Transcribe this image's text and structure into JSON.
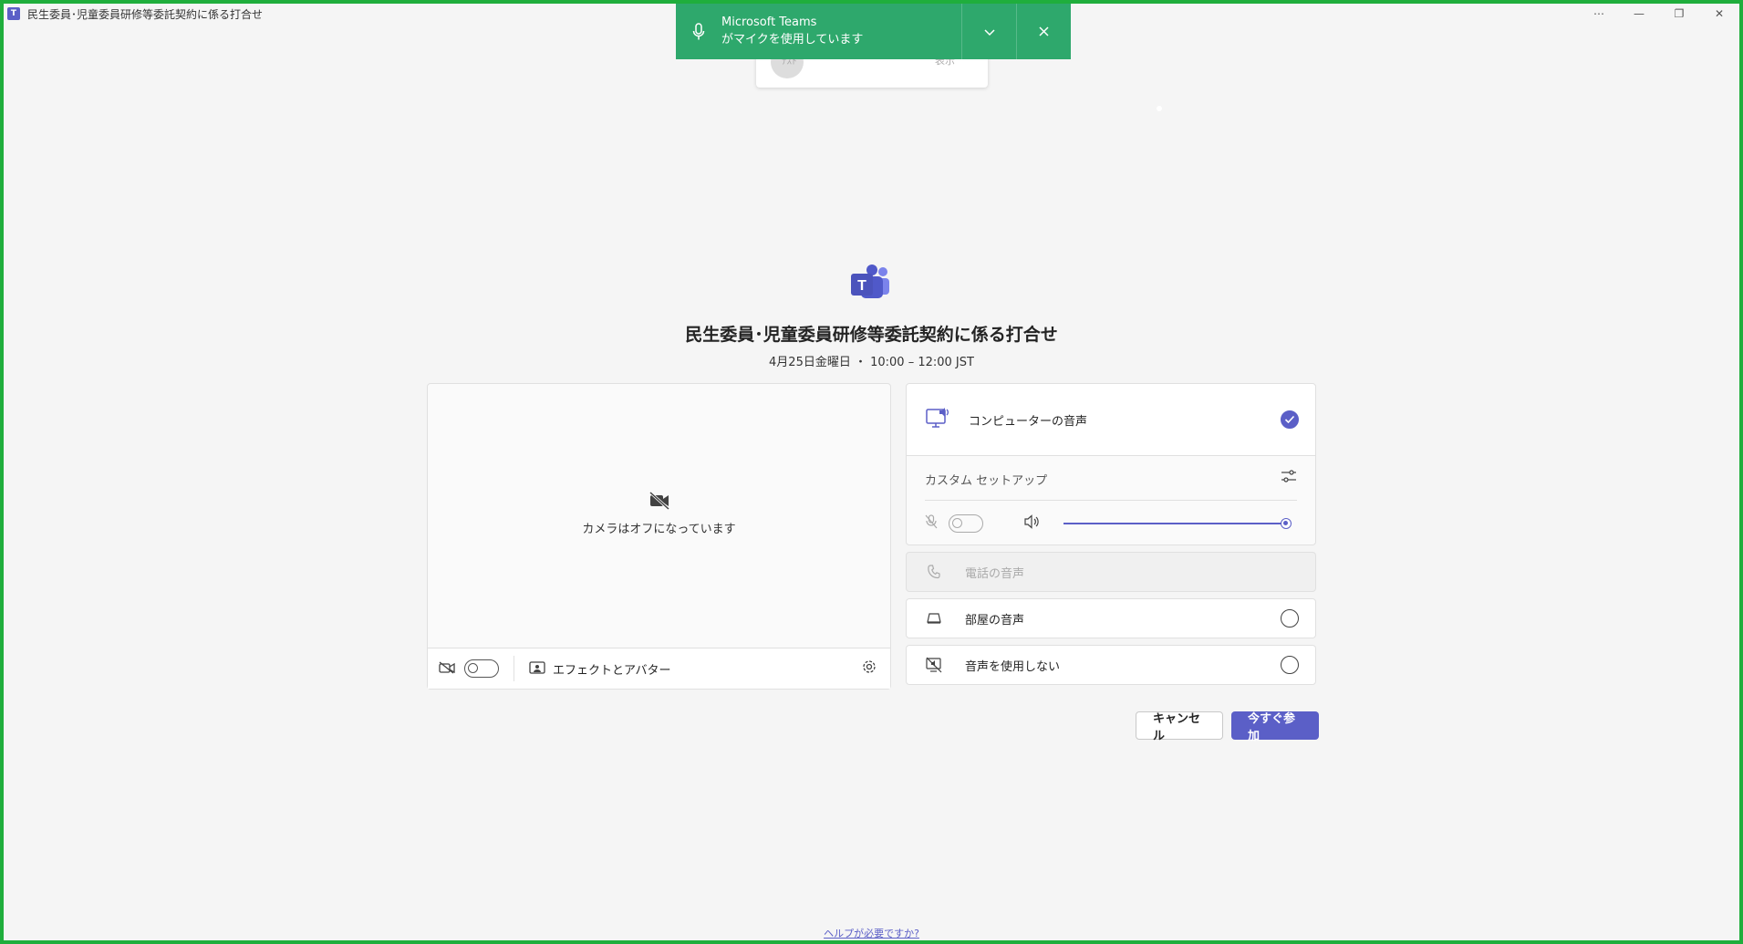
{
  "window": {
    "title": "民生委員･児童委員研修等委託契約に係る打合せ",
    "app_icon_letter": "T",
    "controls": [
      "⋯",
      "—",
      "❐",
      "✕"
    ]
  },
  "background_card": {
    "left_text": "ﾃｽﾄ",
    "right_text": "表示"
  },
  "toast": {
    "app": "Microsoft Teams",
    "message": "がマイクを使用しています",
    "accent": "#2ea86c"
  },
  "meeting": {
    "title": "民生委員･児童委員研修等委託契約に係る打合せ",
    "time": "4月25日金曜日 ・ 10:00 – 12:00 JST"
  },
  "video": {
    "camera_off_label": "カメラはオフになっています",
    "effects_label": "エフェクトとアバター"
  },
  "audio": {
    "computer_audio": "コンピューターの音声",
    "custom_setup": "カスタム セットアップ",
    "volume_level": 1.0,
    "phone_audio": "電話の音声",
    "room_audio": "部屋の音声",
    "no_audio": "音声を使用しない",
    "selected": "computer_audio",
    "accent": "#5b5fc7"
  },
  "actions": {
    "cancel": "キャンセル",
    "join": "今すぐ参加"
  },
  "help_link": "ヘルプが必要ですか?"
}
